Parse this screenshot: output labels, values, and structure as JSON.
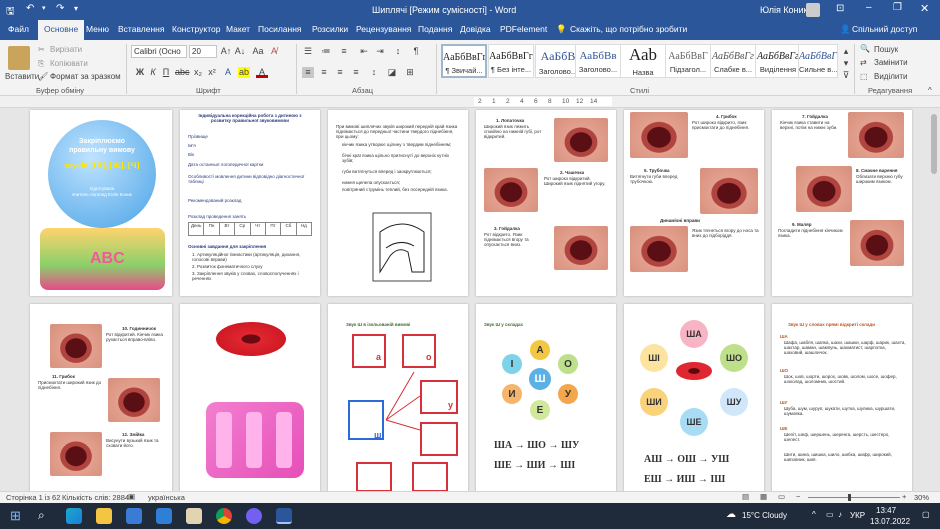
{
  "titlebar": {
    "autosave": "",
    "document_title": "Шиплячі [Режим сумісності] - Word",
    "user": "Юлія Коник",
    "share": "Спільний доступ"
  },
  "tabs": [
    "Файл",
    "Основне",
    "Меню",
    "Вставлення",
    "Конструктор",
    "Макет",
    "Посилання",
    "Розсилки",
    "Рецензування",
    "Подання",
    "Довідка",
    "PDFelement",
    "Скажіть, що потрібно зробити"
  ],
  "ribbon": {
    "paste": "Вставити",
    "cut": "Вирізати",
    "copy": "Копіювати",
    "format_painter": "Формат за зразком",
    "group_clipboard": "Буфер обміну",
    "font_name": "Calibri (Осно",
    "font_size": "20",
    "group_font": "Шрифт",
    "group_paragraph": "Абзац",
    "styles": [
      {
        "preview": "АаБбВвГг",
        "name": "¶ Звичай..."
      },
      {
        "preview": "АаБбВвГг",
        "name": "¶ Без інте..."
      },
      {
        "preview": "АаБбВ",
        "name": "Заголово..."
      },
      {
        "preview": "АаБбВв",
        "name": "Заголово..."
      },
      {
        "preview": "Ааb",
        "name": "Назва"
      },
      {
        "preview": "АаБбВвГ",
        "name": "Підзагол..."
      },
      {
        "preview": "АаБбВвГг",
        "name": "Слабке в..."
      },
      {
        "preview": "АаБбВвГг",
        "name": "Виділення"
      },
      {
        "preview": "АаБбВвГг",
        "name": "Сильне в..."
      }
    ],
    "group_styles": "Стилі",
    "find": "Пошук",
    "replace": "Замінити",
    "select": "Виділити",
    "group_editing": "Редагування"
  },
  "ruler": [
    "2",
    "1",
    "2",
    "4",
    "6",
    "8",
    "10",
    "12",
    "14"
  ],
  "pages": {
    "cover": {
      "line1": "Закріплюємо",
      "line2": "правильну вимову",
      "line3": "звуків [Ш], [Ж], [Ч]",
      "line4": "підготувала",
      "line5": "вчитель-логопед Юлія Коник"
    },
    "p2": {
      "heading": "Індивідуальна корекційна робота з дитиною з розвитку правильної звуковимови",
      "rows": [
        "Прізвище",
        "Ім'я",
        "Вік",
        "Дата останньої логопедичної картки",
        "Особливості мовлення дитини відповідно діагностичної таблиці",
        "Рекомендований розклад",
        "Розклад проведення занять"
      ],
      "days": [
        "День",
        "Пн",
        "Вт",
        "Ср",
        "Чт",
        "Пт",
        "Сб",
        "Нд"
      ],
      "tasks_title": "Основні завдання для закріплення",
      "tasks": [
        "1. Артикуляційної гімнастики (артикуляція, дихання, голосові вправи)",
        "2. Розвиток фонематичного слуху",
        "3. Закріплення звуків у словах, словосполученнях і реченнях"
      ]
    },
    "p3": {
      "intro": "При вимові шиплячих звуків широкий передній край язика піднімається до передньої частини твердого піднебіння, при цьому:",
      "bullets": [
        "кінчик язика утворює щілину з твердим піднебінням;",
        "бічні краї язика щільно притиснуті до верхніх кутніх зубів;",
        "губи витягнуться вперед і заокруглюються;",
        "нижня щелепа опускається;",
        "повітряний струмінь теплий, без посередній язика."
      ]
    },
    "p4": {
      "captions": [
        "1. Лопаточка",
        "2. Чашечка",
        "3. Гойдалка"
      ]
    },
    "p5": {
      "captions": [
        "4. Грибок",
        "5. Трубочка",
        "Динамічні вправи"
      ]
    },
    "p6": {
      "captions": [
        "7. Гойдалка",
        "8. Смачне варення",
        "9. Маляр"
      ]
    },
    "p7": {
      "captions": [
        "10. Годинничок",
        "11. Грибок",
        "12. Змійка"
      ]
    },
    "p9": {
      "title": "Звук Ш в ізольованій вимові",
      "letters": [
        "а",
        "о",
        "ш",
        "у"
      ]
    },
    "p10": {
      "title": "Звук Ш у складах",
      "center": "Ш",
      "vowels": [
        "А",
        "О",
        "У",
        "Е",
        "И",
        "І"
      ],
      "rows": [
        "ША → ШО → ШУ",
        "ШЕ → ШИ → ШІ"
      ]
    },
    "p11": {
      "syllables": [
        "ША",
        "ШО",
        "ШУ",
        "ШЕ",
        "ШИ",
        "ШІ"
      ],
      "rows": [
        "АШ → ОШ → УШ",
        "ЕШ → ИШ → ІШ"
      ]
    },
    "p12": {
      "title": "Звук Ш у словах прямі відкриті склади",
      "labels": [
        "ША",
        "ШО",
        "ШУ",
        "ШЕ"
      ]
    }
  },
  "status": {
    "page": "Сторінка 1 із 62",
    "words": "Кількість слів: 2884",
    "language": "українська",
    "zoom": "30%"
  },
  "taskbar": {
    "weather": "15°C Cloudy",
    "lang": "УКР",
    "time": "13:47",
    "date": "13.07.2022"
  }
}
